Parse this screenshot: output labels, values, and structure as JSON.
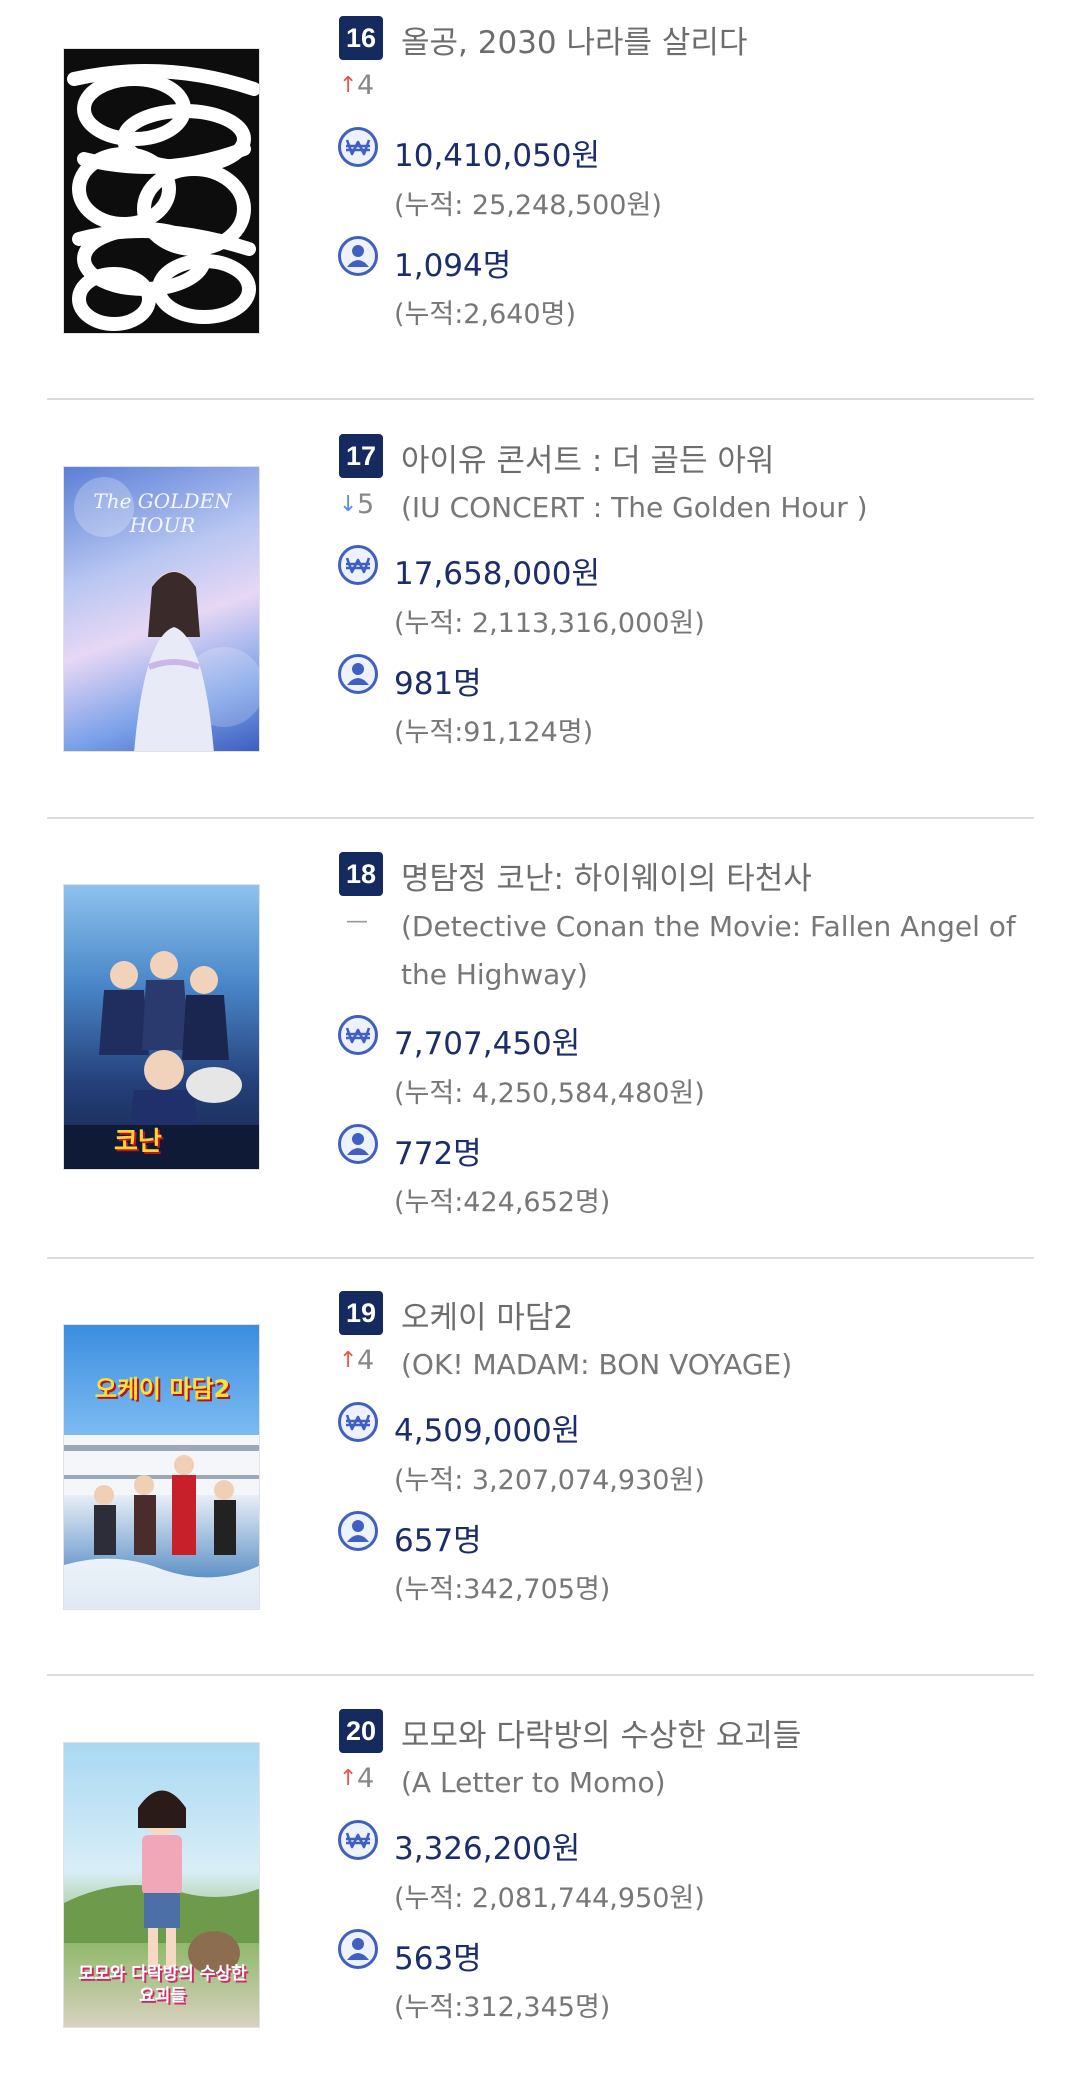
{
  "colors": {
    "badge": "#152a5f",
    "value_text": "#1c2d6b",
    "icon": "#3f5fc1",
    "arrow_up": "#e5584a",
    "arrow_down": "#5b8ee6"
  },
  "movies": [
    {
      "rank": "16",
      "title_ko": "올공, 2030 나라를 살리다",
      "title_en": "",
      "change_dir": "up",
      "change_value": "4",
      "sales": "10,410,050원",
      "sales_total": "(누적: 25,248,500원)",
      "audience": "1,094명",
      "audience_total": "(누적:2,640명)",
      "poster_icon": "poster-scribble"
    },
    {
      "rank": "17",
      "title_ko": "아이유 콘서트 : 더 골든 아워",
      "title_en": "(IU CONCERT : The Golden Hour )",
      "change_dir": "down",
      "change_value": "5",
      "sales": "17,658,000원",
      "sales_total": "(누적: 2,113,316,000원)",
      "audience": "981명",
      "audience_total": "(누적:91,124명)",
      "poster_text": "The GOLDEN HOUR"
    },
    {
      "rank": "18",
      "title_ko": "명탐정 코난: 하이웨이의 타천사",
      "title_en": "(Detective Conan the Movie: Fallen Angel of the Highway)",
      "change_dir": "none",
      "change_value": "",
      "sales": "7,707,450원",
      "sales_total": "(누적: 4,250,584,480원)",
      "audience": "772명",
      "audience_total": "(누적:424,652명)",
      "poster_text": "코난"
    },
    {
      "rank": "19",
      "title_ko": "오케이 마담2",
      "title_en": "(OK! MADAM: BON VOYAGE)",
      "change_dir": "up",
      "change_value": "4",
      "sales": "4,509,000원",
      "sales_total": "(누적: 3,207,074,930원)",
      "audience": "657명",
      "audience_total": "(누적:342,705명)",
      "poster_text": "오케이 마담2"
    },
    {
      "rank": "20",
      "title_ko": "모모와 다락방의 수상한 요괴들",
      "title_en": "(A Letter to Momo)",
      "change_dir": "up",
      "change_value": "4",
      "sales": "3,326,200원",
      "sales_total": "(누적: 2,081,744,950원)",
      "audience": "563명",
      "audience_total": "(누적:312,345명)",
      "poster_text": "모모와 다락방의 수상한 요괴들"
    }
  ]
}
